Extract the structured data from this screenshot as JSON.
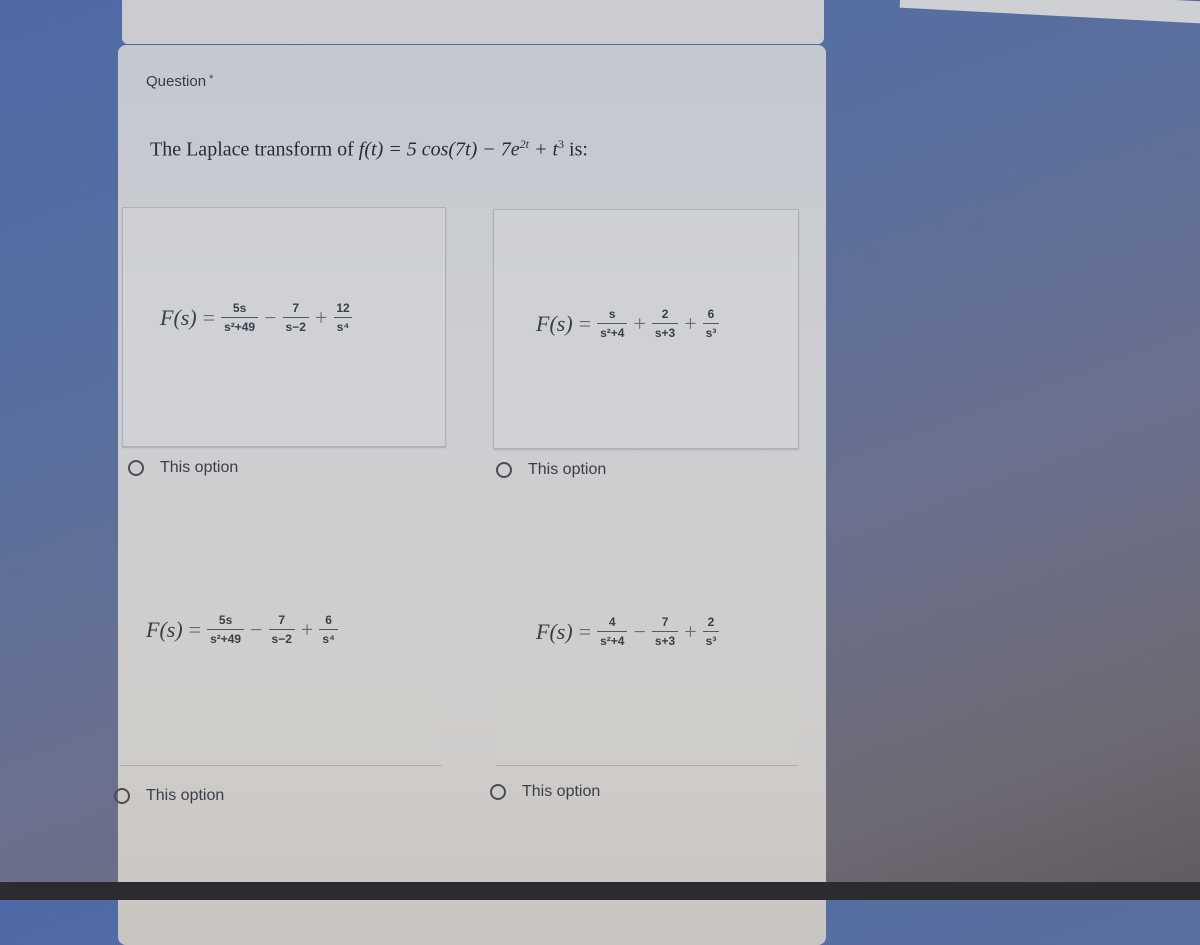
{
  "question": {
    "label": "Question",
    "required_marker": "*",
    "text_prefix": "The Laplace transform of ",
    "function_expr": "f(t) = 5 cos(7t) − 7e",
    "exp_sup": "2t",
    "mid": " + t",
    "t_sup": "3",
    "suffix": " is:"
  },
  "options": [
    {
      "lhs": "F(s)",
      "eq": "=",
      "terms": [
        {
          "num": "5s",
          "den": "s²+49"
        },
        {
          "op": "−",
          "num": "7",
          "den": "s−2"
        },
        {
          "op": "+",
          "num": "12",
          "den": "s⁴"
        }
      ],
      "label": "This option"
    },
    {
      "lhs": "F(s)",
      "eq": "=",
      "terms": [
        {
          "num": "s",
          "den": "s²+4"
        },
        {
          "op": "+",
          "num": "2",
          "den": "s+3"
        },
        {
          "op": "+",
          "num": "6",
          "den": "s³"
        }
      ],
      "label": "This option"
    },
    {
      "lhs": "F(s)",
      "eq": "=",
      "terms": [
        {
          "num": "5s",
          "den": "s²+49"
        },
        {
          "op": "−",
          "num": "7",
          "den": "s−2"
        },
        {
          "op": "+",
          "num": "6",
          "den": "s⁴"
        }
      ],
      "label": "This option"
    },
    {
      "lhs": "F(s)",
      "eq": "=",
      "terms": [
        {
          "num": "4",
          "den": "s²+4"
        },
        {
          "op": "−",
          "num": "7",
          "den": "s+3"
        },
        {
          "op": "+",
          "num": "2",
          "den": "s³"
        }
      ],
      "label": "This option"
    }
  ]
}
